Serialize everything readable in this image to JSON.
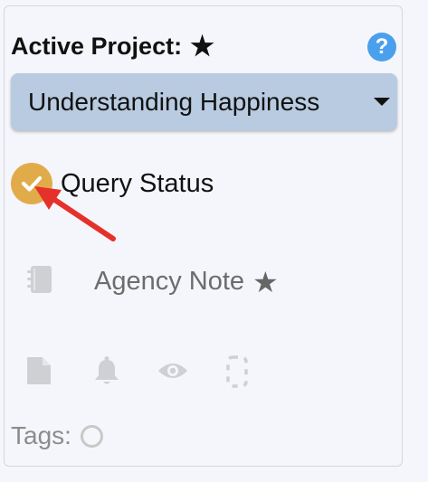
{
  "header": {
    "title": "Active Project:",
    "star_icon": "star-icon",
    "help_label": "?"
  },
  "project_select": {
    "selected": "Understanding Happiness"
  },
  "query_status": {
    "label": "Query Status",
    "icon": "checkmark-icon",
    "icon_color": "#e2ab4a"
  },
  "annotation": {
    "arrow_color": "#e5312a"
  },
  "agency_note": {
    "label": "Agency Note",
    "icon": "notebook-icon"
  },
  "action_icons": [
    "document-icon",
    "bell-icon",
    "eye-icon",
    "phone-icon"
  ],
  "tags": {
    "label": "Tags:"
  },
  "colors": {
    "accent_blue": "#4aa0ec",
    "select_background": "#b9cbe1",
    "muted_icon": "#cfd0d4"
  }
}
